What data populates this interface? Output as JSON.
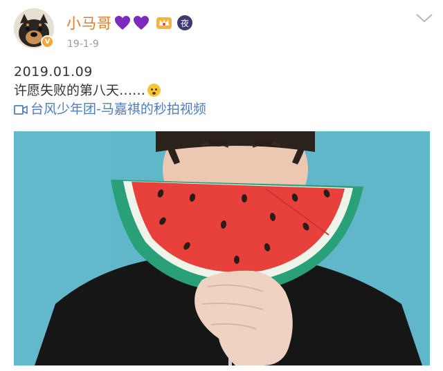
{
  "post": {
    "username": "小马哥",
    "post_date": "19-1-9",
    "badge_night_label": "夜",
    "verified_label": "V",
    "content": {
      "date_line": "2019.01.09",
      "text_line": "许愿失败的第八天……",
      "video_link": "台风少年团-马嘉祺的秒拍视频"
    }
  },
  "colors": {
    "username": "#e87a22",
    "link": "#4f7cc0",
    "heart": "#7b2cbf",
    "date": "#9b9b9b"
  },
  "icons": {
    "hearts": [
      "purple-heart-icon",
      "purple-heart-icon"
    ],
    "badges": [
      "crown-badge-icon",
      "night-badge-icon"
    ],
    "emoji": "upside-down-face-emoji",
    "link": "video-icon",
    "menu": "chevron-down-icon"
  }
}
